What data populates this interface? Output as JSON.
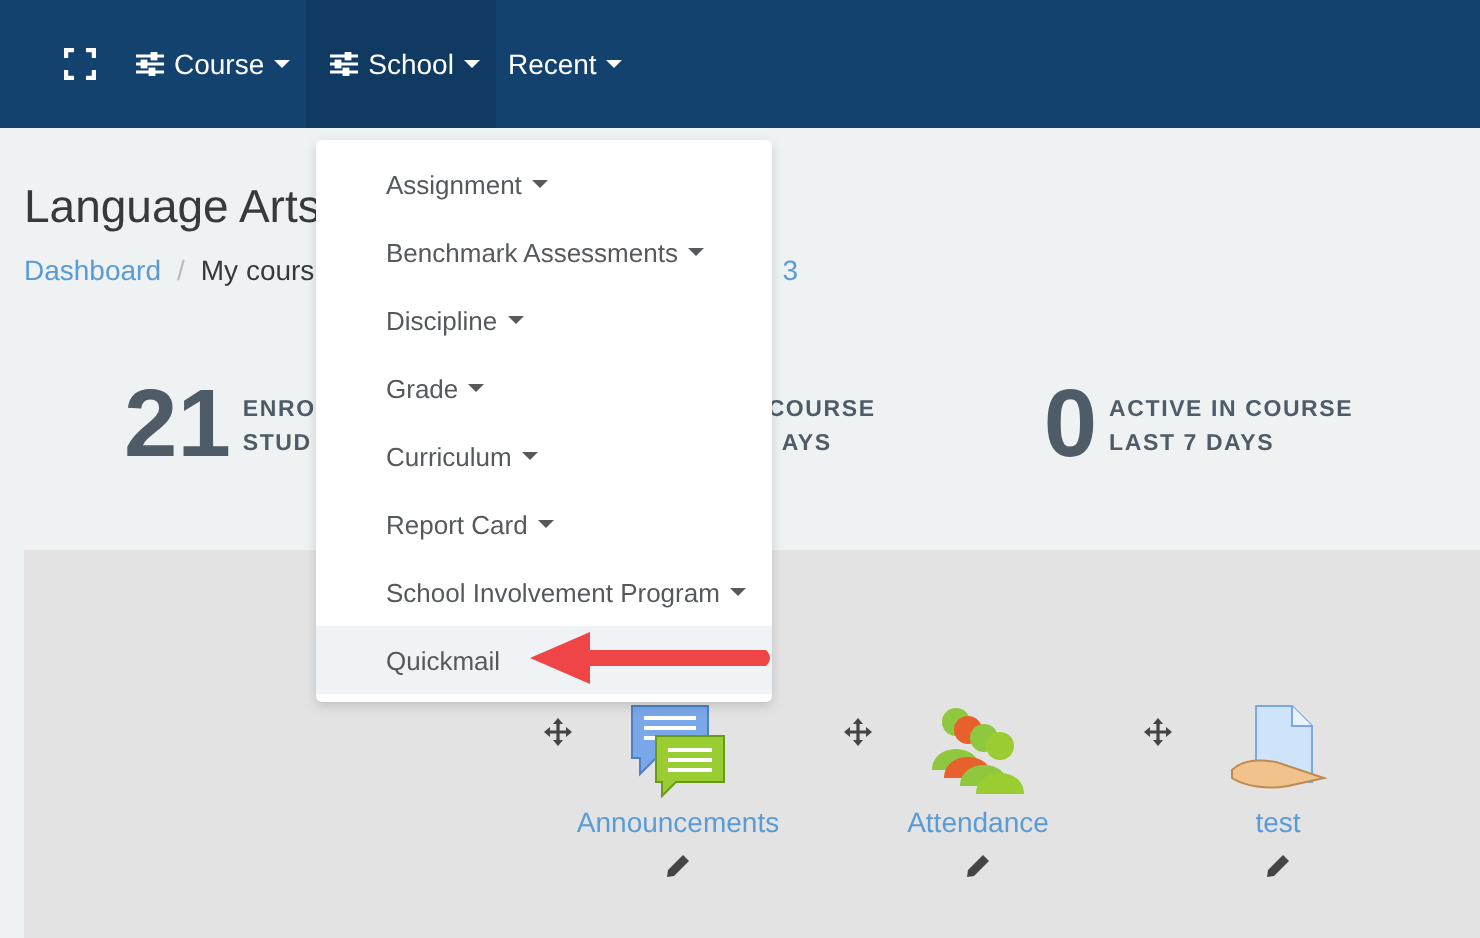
{
  "navbar": {
    "items": [
      {
        "label": "Course",
        "kind": "filter",
        "selected": false
      },
      {
        "label": "School",
        "kind": "filter",
        "selected": true
      },
      {
        "label": "Recent",
        "kind": "plain",
        "selected": false
      }
    ]
  },
  "page_title": "Language Arts",
  "breadcrumb": [
    {
      "label": "Dashboard",
      "kind": "link"
    },
    {
      "label": "/",
      "kind": "separator"
    },
    {
      "label": "My cours",
      "kind": "text"
    }
  ],
  "breadcrumb_tail": "3",
  "stats": [
    {
      "value": "21",
      "lines": [
        "ENRO",
        "STUD"
      ]
    },
    {
      "lines": [
        "COURSE",
        "AYS"
      ]
    },
    {
      "value": "0",
      "lines": [
        "ACTIVE IN COURSE",
        "LAST 7 DAYS"
      ]
    }
  ],
  "menu": {
    "items": [
      {
        "label": "Assignment",
        "submenu": true,
        "selected": false
      },
      {
        "label": "Benchmark Assessments",
        "submenu": true,
        "selected": false
      },
      {
        "label": "Discipline",
        "submenu": true,
        "selected": false
      },
      {
        "label": "Grade",
        "submenu": true,
        "selected": false
      },
      {
        "label": "Curriculum",
        "submenu": true,
        "selected": false
      },
      {
        "label": "Report Card",
        "submenu": true,
        "selected": false
      },
      {
        "label": "School Involvement Program",
        "submenu": true,
        "selected": false
      },
      {
        "label": "Quickmail",
        "submenu": false,
        "selected": true
      }
    ]
  },
  "activities": [
    {
      "label": "Announcements",
      "kind": "forum"
    },
    {
      "label": "Attendance",
      "kind": "attendance"
    },
    {
      "label": "test",
      "kind": "assign"
    }
  ]
}
